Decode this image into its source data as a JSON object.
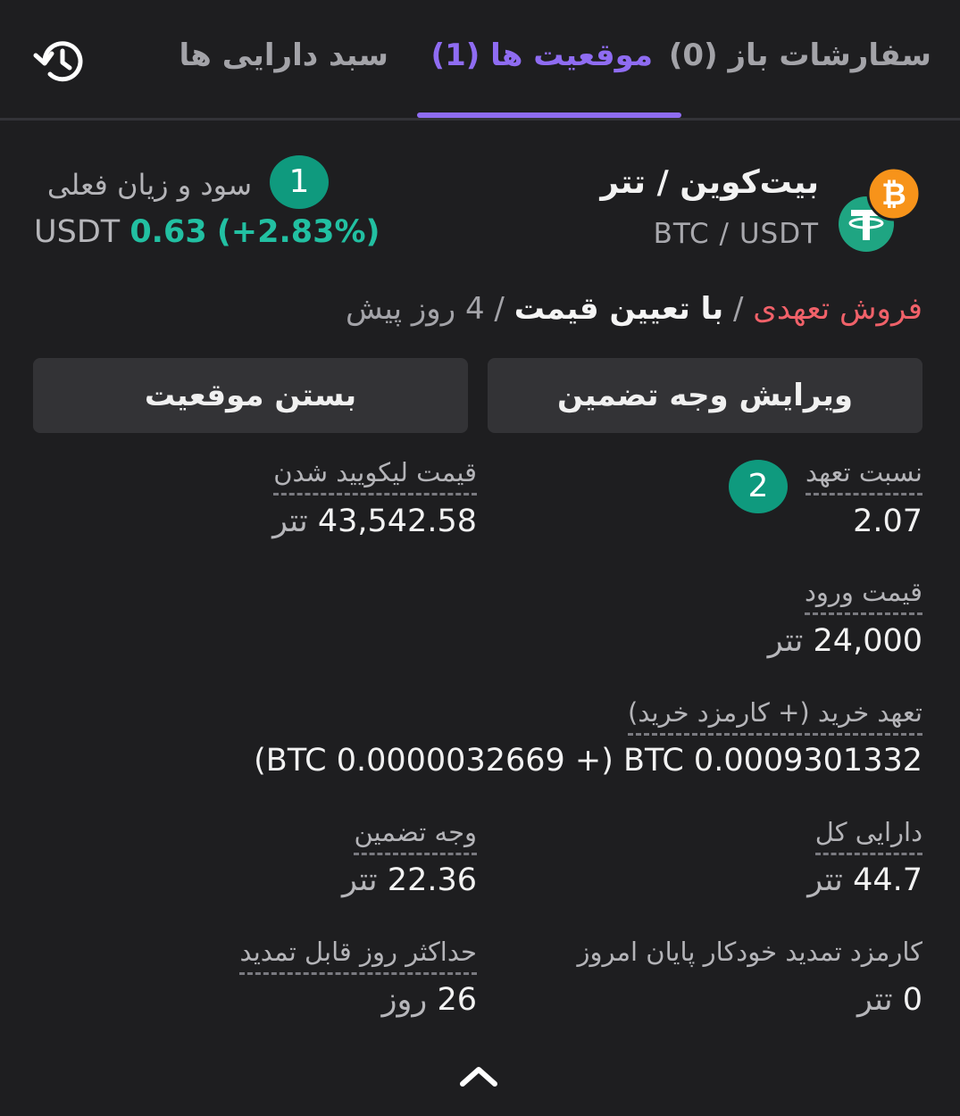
{
  "tabs": {
    "open_orders": "سفارشات باز (0)",
    "positions": "موقعیت ها (1)",
    "portfolio": "سبد دارایی ها"
  },
  "pair": {
    "title": "بیت‌کوین / تتر",
    "symbol": "BTC / USDT",
    "base_icon": "bitcoin-icon",
    "quote_icon": "tether-icon"
  },
  "pnl": {
    "label": "سود و زیان فعلی",
    "currency": "USDT",
    "amount": "0.63",
    "percent": "(+2.83%)"
  },
  "badges": {
    "one": "1",
    "two": "2"
  },
  "position_info": {
    "side": "فروش تعهدی",
    "separator": "/",
    "order_type": "با تعیین قیمت",
    "time": "4 روز پیش"
  },
  "buttons": {
    "edit_margin": "ویرایش وجه تضمین",
    "close_position": "بستن موقعیت"
  },
  "fields": {
    "leverage": {
      "label": "نسبت تعهد",
      "value": "2.07"
    },
    "liquidation": {
      "label": "قیمت لیکویید شدن",
      "value": "43,542.58",
      "unit": "تتر"
    },
    "entry": {
      "label": "قیمت ورود",
      "value": "24,000",
      "unit": "تتر"
    },
    "commitment": {
      "label": "تعهد خرید (+ کارمزد خرید)",
      "value": "(BTC 0.0000032669 +) BTC 0.0009301332"
    },
    "total_assets": {
      "label": "دارایی کل",
      "value": "44.7",
      "unit": "تتر"
    },
    "margin": {
      "label": "وجه تضمین",
      "value": "22.36",
      "unit": "تتر"
    },
    "renewal_fee": {
      "label": "کارمزد تمدید خودکار پایان امروز",
      "value": "0",
      "unit": "تتر"
    },
    "max_days": {
      "label": "حداکثر روز قابل تمدید",
      "value": "26",
      "unit": "روز"
    }
  },
  "colors": {
    "accent": "#8f6cf2",
    "profit": "#22c0a2",
    "sell": "#f06169",
    "badge": "#0f9a7e"
  }
}
